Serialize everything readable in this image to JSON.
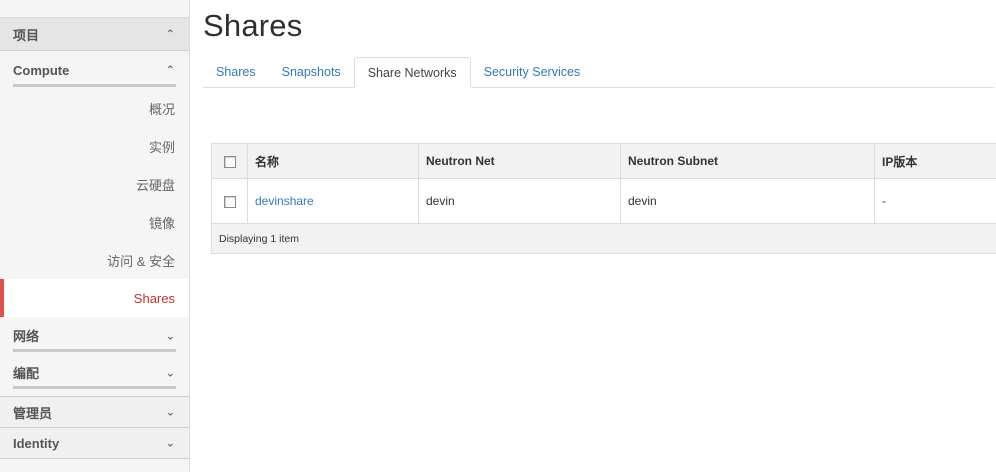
{
  "sidebar": {
    "project_label": "项目",
    "compute_label": "Compute",
    "items": [
      {
        "label": "概况"
      },
      {
        "label": "实例"
      },
      {
        "label": "云硬盘"
      },
      {
        "label": "镜像"
      },
      {
        "label": "访问 & 安全"
      },
      {
        "label": "Shares",
        "active": true
      }
    ],
    "network_label": "网络",
    "orchestration_label": "编配",
    "admin_label": "管理员",
    "identity_label": "Identity"
  },
  "page": {
    "title": "Shares"
  },
  "tabs": [
    {
      "label": "Shares"
    },
    {
      "label": "Snapshots"
    },
    {
      "label": "Share Networks",
      "active": true
    },
    {
      "label": "Security Services"
    }
  ],
  "table": {
    "columns": [
      "名称",
      "Neutron Net",
      "Neutron Subnet",
      "IP版本"
    ],
    "rows": [
      {
        "name": "devinshare",
        "neutron_net": "devin",
        "neutron_subnet": "devin",
        "ip_version": "-"
      }
    ],
    "footer": "Displaying 1 item"
  },
  "colors": {
    "accent": "#d9534f",
    "link": "#337ab7"
  }
}
